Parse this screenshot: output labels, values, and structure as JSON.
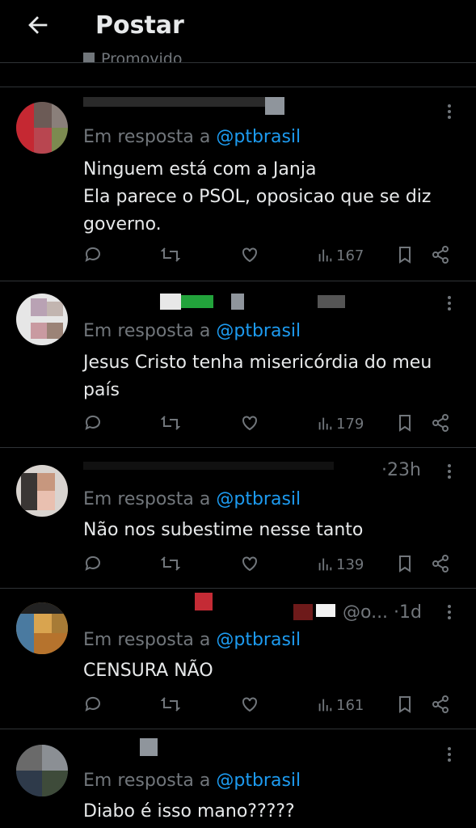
{
  "header": {
    "title": "Postar"
  },
  "promoted": {
    "label": "Promovido"
  },
  "replies": [
    {
      "meta": "",
      "in_reply_prefix": "Em resposta a",
      "mention": "@ptbrasil",
      "text": "Ninguem está com a Janja\nEla parece o PSOL, oposicao que se diz governo.",
      "views": "167"
    },
    {
      "meta": "",
      "in_reply_prefix": "Em resposta a",
      "mention": "@ptbrasil",
      "text": "Jesus Cristo tenha misericórdia do meu país",
      "views": "179"
    },
    {
      "meta": "·23h",
      "in_reply_prefix": "Em resposta a",
      "mention": "@ptbrasil",
      "text": "Não nos subestime nesse tanto",
      "views": "139"
    },
    {
      "meta": "@o... ·1d",
      "in_reply_prefix": "Em resposta a",
      "mention": "@ptbrasil",
      "text": "CENSURA NÃO",
      "views": "161"
    },
    {
      "meta": "",
      "in_reply_prefix": "Em resposta a",
      "mention": "@ptbrasil",
      "text": "Diabo é isso mano?????",
      "views": ""
    }
  ],
  "icons": {
    "back": "arrow-left-icon",
    "reply": "comment-icon",
    "retweet": "repost-icon",
    "like": "heart-icon",
    "views": "bar-chart-icon",
    "bookmark": "bookmark-icon",
    "share": "share-icon",
    "more": "more-dots-icon"
  },
  "colors": {
    "accent": "#1d9bf0",
    "muted": "#71767b",
    "text": "#e7e9ea",
    "background": "#000000"
  }
}
